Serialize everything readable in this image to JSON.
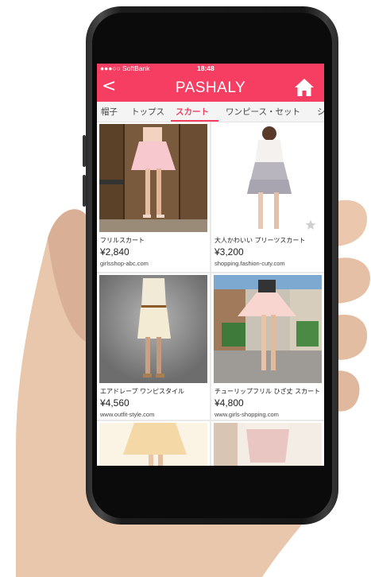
{
  "status_bar": {
    "carrier": "●●●○○ SoftBank",
    "time": "18:48"
  },
  "nav": {
    "back": "<",
    "title": "PASHALY",
    "home_icon": "home-icon"
  },
  "tabs": [
    {
      "label": "帽子",
      "active": false
    },
    {
      "label": "トップス",
      "active": false
    },
    {
      "label": "スカート",
      "active": true
    },
    {
      "label": "ワンピース・セット",
      "active": false
    },
    {
      "label": "シ",
      "active": false
    }
  ],
  "products": [
    {
      "name": "フリルスカート",
      "price": "¥2,840",
      "site": "girlsshop-abc.com"
    },
    {
      "name": "大人かわいい プリーツスカート",
      "price": "¥3,200",
      "site": "shopping.fashion-cuty.com"
    },
    {
      "name": "エアドレープ ワンピスタイル",
      "price": "¥4,560",
      "site": "www.outfit-style.com"
    },
    {
      "name": "チューリップフリル ひざ丈 スカート",
      "price": "¥4,800",
      "site": "www.girls-shopping.com"
    }
  ],
  "colors": {
    "accent": "#f53e62",
    "tab_bg": "#f4f4f4"
  }
}
